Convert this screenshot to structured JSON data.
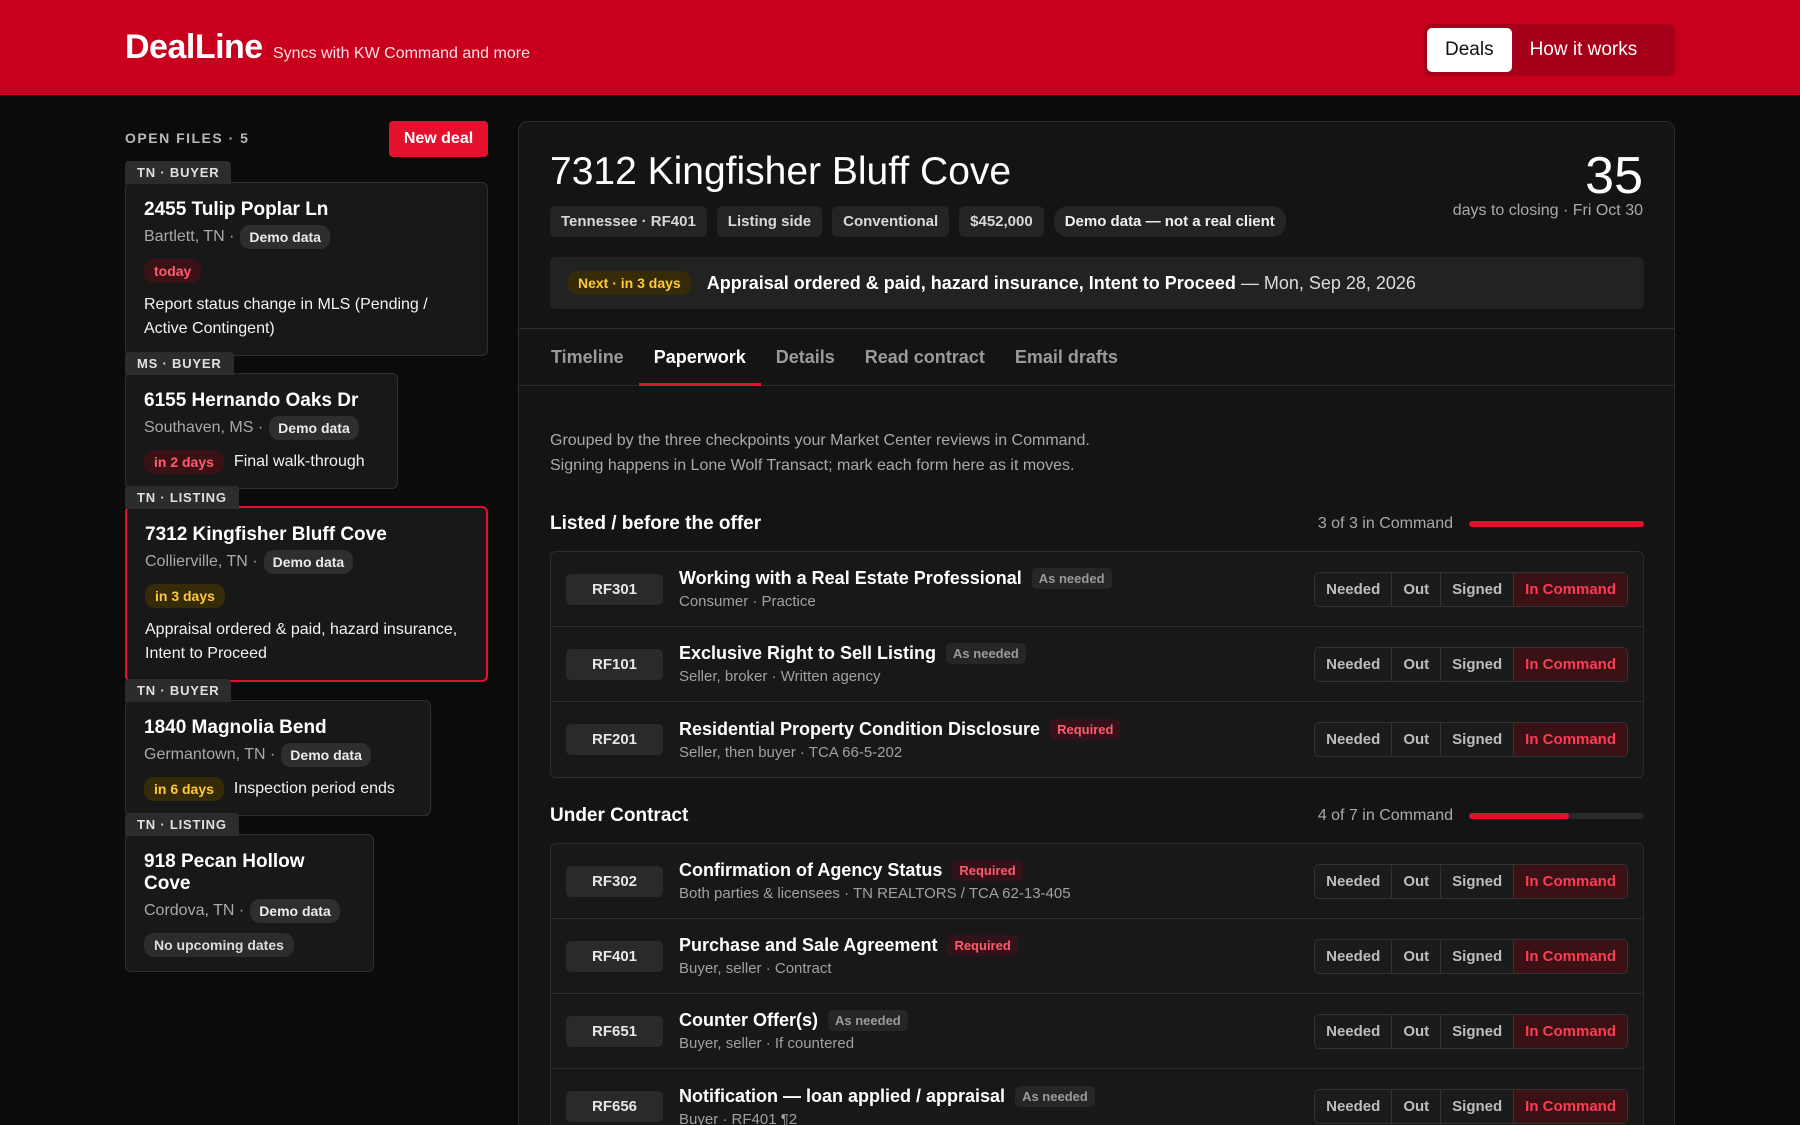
{
  "header": {
    "brand": "DealLine",
    "tagline": "Syncs with KW Command and more",
    "nav": [
      {
        "label": "Deals",
        "active": true
      },
      {
        "label": "How it works",
        "active": false
      }
    ],
    "accent": "#c8001e"
  },
  "sidebar": {
    "heading": "OPEN FILES · 5",
    "new_deal": "New deal",
    "deals": [
      {
        "tag": "TN · BUYER",
        "title": "2455 Tulip Poplar Ln",
        "city": "Bartlett, TN ·",
        "demo": "Demo data",
        "when": "today",
        "when_color": "red",
        "note": "Report status change in MLS (Pending / Active Contingent)"
      },
      {
        "tag": "MS · BUYER",
        "title": "6155 Hernando Oaks Dr",
        "city": "Southaven, MS ·",
        "demo": "Demo data",
        "when": "in 2 days",
        "when_color": "red",
        "note": "Final walk-through"
      },
      {
        "tag": "TN · LISTING",
        "title": "7312 Kingfisher Bluff Cove",
        "city": "Collierville, TN ·",
        "demo": "Demo data",
        "when": "in 3 days",
        "when_color": "yellow",
        "note": "Appraisal ordered & paid, hazard insurance, Intent to Proceed"
      },
      {
        "tag": "TN · BUYER",
        "title": "1840 Magnolia Bend",
        "city": "Germantown, TN ·",
        "demo": "Demo data",
        "when": "in 6 days",
        "when_color": "yellow",
        "note": "Inspection period ends"
      },
      {
        "tag": "TN · LISTING",
        "title": "918 Pecan Hollow Cove",
        "city": "Cordova, TN ·",
        "demo": "Demo data",
        "when": "No upcoming dates",
        "when_color": "gray",
        "note": ""
      }
    ]
  },
  "main": {
    "address": "7312 Kingfisher Bluff Cove",
    "chips": [
      "Tennessee · RF401",
      "Listing side",
      "Conventional",
      "$452,000",
      "Demo data — not a real client"
    ],
    "days_number": "35",
    "days_label": "days to closing · Fri Oct 30",
    "next": {
      "tag": "Next · in 3 days",
      "text": "Appraisal ordered & paid, hazard insurance, Intent to Proceed",
      "date": "— Mon, Sep 28, 2026"
    },
    "tabs": [
      "Timeline",
      "Paperwork",
      "Details",
      "Read contract",
      "Email drafts"
    ],
    "active_tab": "Paperwork",
    "intro_line1": "Grouped by the three checkpoints your Market Center reviews in Command.",
    "intro_line2": "Signing happens in Lone Wolf Transact; mark each form here as it moves.",
    "status_options": [
      "Needed",
      "Out",
      "Signed",
      "In Command"
    ],
    "sections": [
      {
        "title": "Listed / before the offer",
        "progress_text": "3 of 3 in Command",
        "progress": 1.0,
        "forms": [
          {
            "code": "RF301",
            "name": "Working with a Real Estate Professional",
            "badge": "As needed",
            "badge_type": "asneeded",
            "sub": "Consumer · Practice",
            "status": "In Command"
          },
          {
            "code": "RF101",
            "name": "Exclusive Right to Sell Listing",
            "badge": "As needed",
            "badge_type": "asneeded",
            "sub": "Seller, broker · Written agency",
            "status": "In Command"
          },
          {
            "code": "RF201",
            "name": "Residential Property Condition Disclosure",
            "badge": "Required",
            "badge_type": "required",
            "sub": "Seller, then buyer · TCA 66-5-202",
            "status": "In Command"
          }
        ]
      },
      {
        "title": "Under Contract",
        "progress_text": "4 of 7 in Command",
        "progress": 0.571,
        "forms": [
          {
            "code": "RF302",
            "name": "Confirmation of Agency Status",
            "badge": "Required",
            "badge_type": "required",
            "sub": "Both parties & licensees · TN REALTORS / TCA 62-13-405",
            "status": "In Command"
          },
          {
            "code": "RF401",
            "name": "Purchase and Sale Agreement",
            "badge": "Required",
            "badge_type": "required",
            "sub": "Buyer, seller · Contract",
            "status": "In Command"
          },
          {
            "code": "RF651",
            "name": "Counter Offer(s)",
            "badge": "As needed",
            "badge_type": "asneeded",
            "sub": "Buyer, seller · If countered",
            "status": "In Command"
          },
          {
            "code": "RF656",
            "name": "Notification — loan applied / appraisal",
            "badge": "As needed",
            "badge_type": "asneeded",
            "sub": "Buyer · RF401 ¶2",
            "status": "In Command"
          }
        ]
      }
    ]
  }
}
